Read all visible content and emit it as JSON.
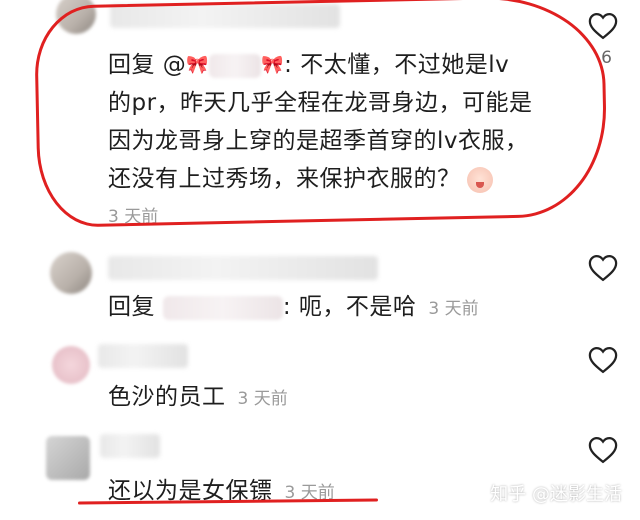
{
  "comments": [
    {
      "reply_prefix": "回复 @",
      "lines": [
        ": 不太懂，不过她是lv",
        "的pr，昨天几乎全程在龙哥身边，可能是",
        "因为龙哥身上穿的是超季首穿的lv衣服，",
        "还没有上过秀场，来保护衣服的？"
      ],
      "time": "3 天前",
      "likes": "6"
    },
    {
      "reply_prefix": "回复",
      "text": ": 呃，不是哈",
      "time": "3 天前"
    },
    {
      "text": "色沙的员工",
      "time": "3 天前"
    },
    {
      "text": "还以为是女保镖",
      "time": "3 天前"
    }
  ],
  "watermark": "知乎 @迷影生活",
  "colors": {
    "annotation": "#e02020",
    "text": "#1e1e1e",
    "muted": "#9a9a9a"
  }
}
